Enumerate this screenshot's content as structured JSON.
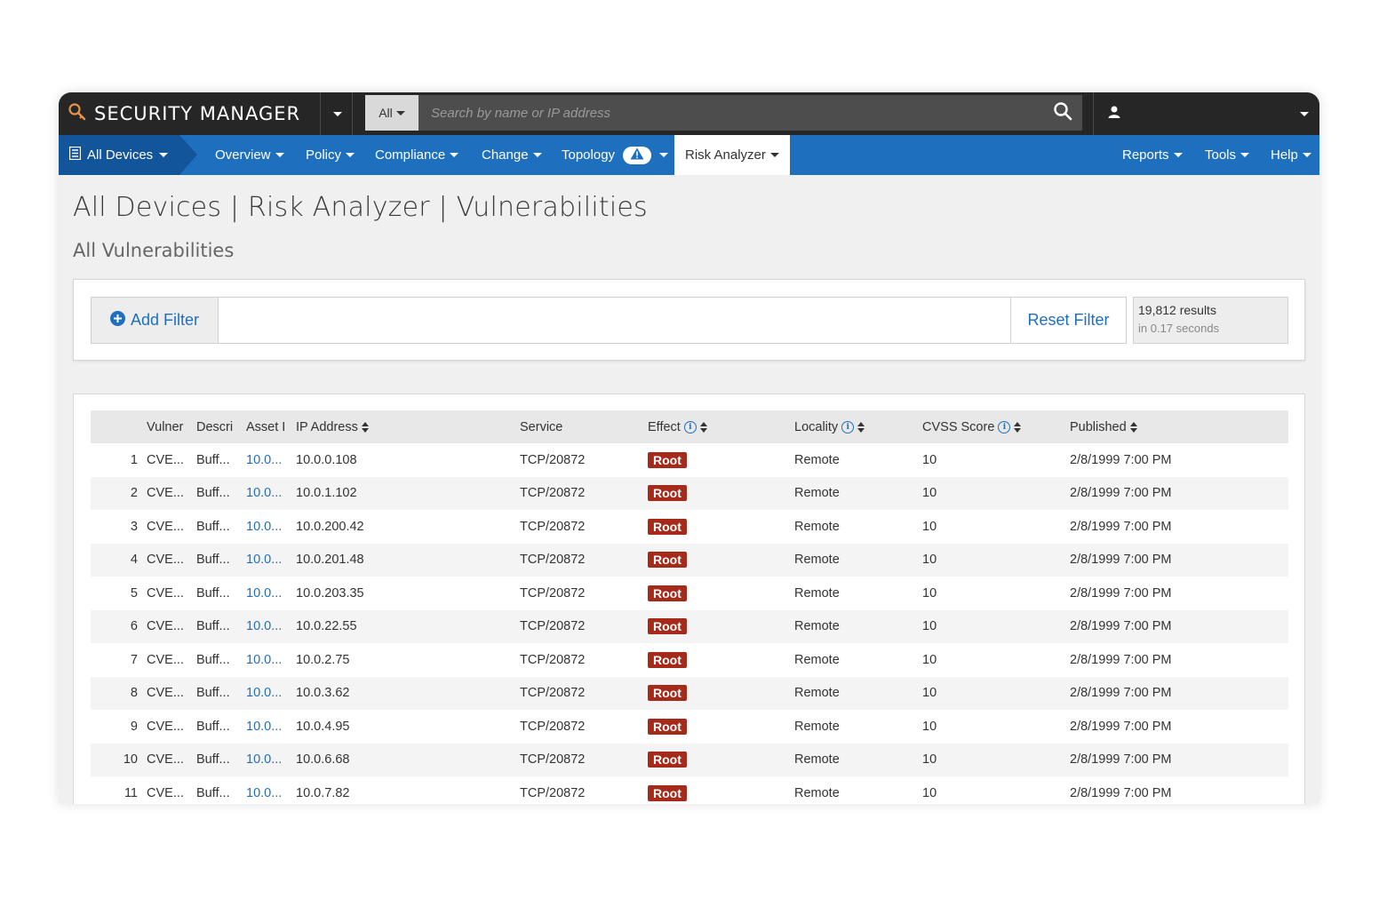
{
  "app": {
    "brand": "SECURITY MANAGER",
    "search_scope": "All",
    "search_placeholder": "Search by name or IP address"
  },
  "nav": {
    "devices_label": "All Devices",
    "items": [
      "Overview",
      "Policy",
      "Compliance",
      "Change",
      "Topology",
      "Risk Analyzer"
    ],
    "right_items": [
      "Reports",
      "Tools",
      "Help"
    ]
  },
  "page": {
    "title": "All Devices | Risk Analyzer | Vulnerabilities",
    "subtitle": "All Vulnerabilities"
  },
  "filter": {
    "add_label": "Add Filter",
    "reset_label": "Reset Filter",
    "results_count": "19,812 results",
    "results_time": "in 0.17 seconds"
  },
  "table": {
    "headers": {
      "vuln": "Vulner",
      "desc": "Descri",
      "asset": "Asset I",
      "ip": "IP Address",
      "service": "Service",
      "effect": "Effect",
      "locality": "Locality",
      "cvss": "CVSS Score",
      "published": "Published"
    },
    "rows": [
      {
        "num": "1",
        "vuln": "CVE...",
        "desc": "Buff...",
        "asset": "10.0...",
        "ip": "10.0.0.108",
        "service": "TCP/20872",
        "effect": "Root",
        "locality": "Remote",
        "cvss": "10",
        "published": "2/8/1999 7:00 PM"
      },
      {
        "num": "2",
        "vuln": "CVE...",
        "desc": "Buff...",
        "asset": "10.0...",
        "ip": "10.0.1.102",
        "service": "TCP/20872",
        "effect": "Root",
        "locality": "Remote",
        "cvss": "10",
        "published": "2/8/1999 7:00 PM"
      },
      {
        "num": "3",
        "vuln": "CVE...",
        "desc": "Buff...",
        "asset": "10.0...",
        "ip": "10.0.200.42",
        "service": "TCP/20872",
        "effect": "Root",
        "locality": "Remote",
        "cvss": "10",
        "published": "2/8/1999 7:00 PM"
      },
      {
        "num": "4",
        "vuln": "CVE...",
        "desc": "Buff...",
        "asset": "10.0...",
        "ip": "10.0.201.48",
        "service": "TCP/20872",
        "effect": "Root",
        "locality": "Remote",
        "cvss": "10",
        "published": "2/8/1999 7:00 PM"
      },
      {
        "num": "5",
        "vuln": "CVE...",
        "desc": "Buff...",
        "asset": "10.0...",
        "ip": "10.0.203.35",
        "service": "TCP/20872",
        "effect": "Root",
        "locality": "Remote",
        "cvss": "10",
        "published": "2/8/1999 7:00 PM"
      },
      {
        "num": "6",
        "vuln": "CVE...",
        "desc": "Buff...",
        "asset": "10.0...",
        "ip": "10.0.22.55",
        "service": "TCP/20872",
        "effect": "Root",
        "locality": "Remote",
        "cvss": "10",
        "published": "2/8/1999 7:00 PM"
      },
      {
        "num": "7",
        "vuln": "CVE...",
        "desc": "Buff...",
        "asset": "10.0...",
        "ip": "10.0.2.75",
        "service": "TCP/20872",
        "effect": "Root",
        "locality": "Remote",
        "cvss": "10",
        "published": "2/8/1999 7:00 PM"
      },
      {
        "num": "8",
        "vuln": "CVE...",
        "desc": "Buff...",
        "asset": "10.0...",
        "ip": "10.0.3.62",
        "service": "TCP/20872",
        "effect": "Root",
        "locality": "Remote",
        "cvss": "10",
        "published": "2/8/1999 7:00 PM"
      },
      {
        "num": "9",
        "vuln": "CVE...",
        "desc": "Buff...",
        "asset": "10.0...",
        "ip": "10.0.4.95",
        "service": "TCP/20872",
        "effect": "Root",
        "locality": "Remote",
        "cvss": "10",
        "published": "2/8/1999 7:00 PM"
      },
      {
        "num": "10",
        "vuln": "CVE...",
        "desc": "Buff...",
        "asset": "10.0...",
        "ip": "10.0.6.68",
        "service": "TCP/20872",
        "effect": "Root",
        "locality": "Remote",
        "cvss": "10",
        "published": "2/8/1999 7:00 PM"
      },
      {
        "num": "11",
        "vuln": "CVE...",
        "desc": "Buff...",
        "asset": "10.0...",
        "ip": "10.0.7.82",
        "service": "TCP/20872",
        "effect": "Root",
        "locality": "Remote",
        "cvss": "10",
        "published": "2/8/1999 7:00 PM"
      }
    ]
  },
  "icons": {
    "brand": "magnifier-key-icon",
    "search": "search-icon",
    "user": "user-icon",
    "devices": "device-list-icon",
    "warning": "warning-icon",
    "info": "info-icon",
    "sort": "sort-icon",
    "add": "plus-circle-icon"
  },
  "colors": {
    "topbar": "#262626",
    "nav": "#1f6fbf",
    "nav_dark": "#13559a",
    "link": "#1f6fbf",
    "root_badge": "#a52a1a",
    "brand_icon": "#e8934a"
  }
}
